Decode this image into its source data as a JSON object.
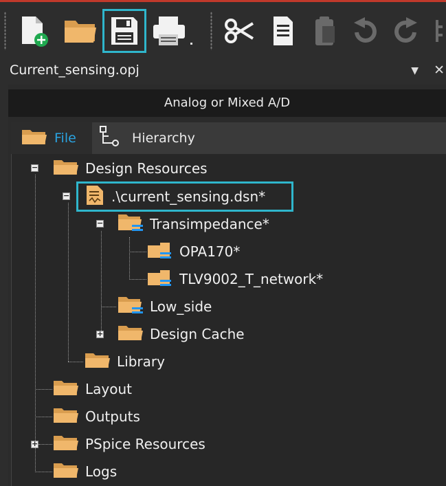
{
  "toolbar": {
    "buttons": [
      {
        "id": "new",
        "icon": "new-file-icon"
      },
      {
        "id": "open",
        "icon": "open-folder-icon"
      },
      {
        "id": "save",
        "icon": "save-icon",
        "highlighted": true
      },
      {
        "id": "print",
        "icon": "print-icon"
      },
      {
        "id": "cut",
        "icon": "cut-icon"
      },
      {
        "id": "copy",
        "icon": "copy-icon"
      },
      {
        "id": "paste",
        "icon": "paste-icon"
      },
      {
        "id": "undo",
        "icon": "undo-icon"
      },
      {
        "id": "redo",
        "icon": "redo-icon"
      }
    ],
    "highlight_color": "#2fb6cc"
  },
  "panel": {
    "title": "Current_sensing.opj",
    "dropdown_glyph": "▼",
    "close_glyph": "✕"
  },
  "mode": "Analog or Mixed A/D",
  "tabs": [
    {
      "label": "File",
      "icon": "folder-icon",
      "active": true
    },
    {
      "label": "Hierarchy",
      "icon": "hierarchy-icon",
      "active": false
    }
  ],
  "tree": {
    "design_resources": "Design Resources",
    "dsn_file": ".\\current_sensing.dsn*",
    "transimpedance": "Transimpedance*",
    "opa170": "OPA170*",
    "tlv9002": "TLV9002_T_network*",
    "low_side": "Low_side",
    "design_cache": "Design Cache",
    "library": "Library",
    "layout": "Layout",
    "outputs": "Outputs",
    "pspice_resources": "PSpice Resources",
    "logs": "Logs"
  },
  "colors": {
    "accent_tab": "#2aa3e0",
    "folder": "#f0b76b",
    "schematic_blue": "#2196f3"
  }
}
